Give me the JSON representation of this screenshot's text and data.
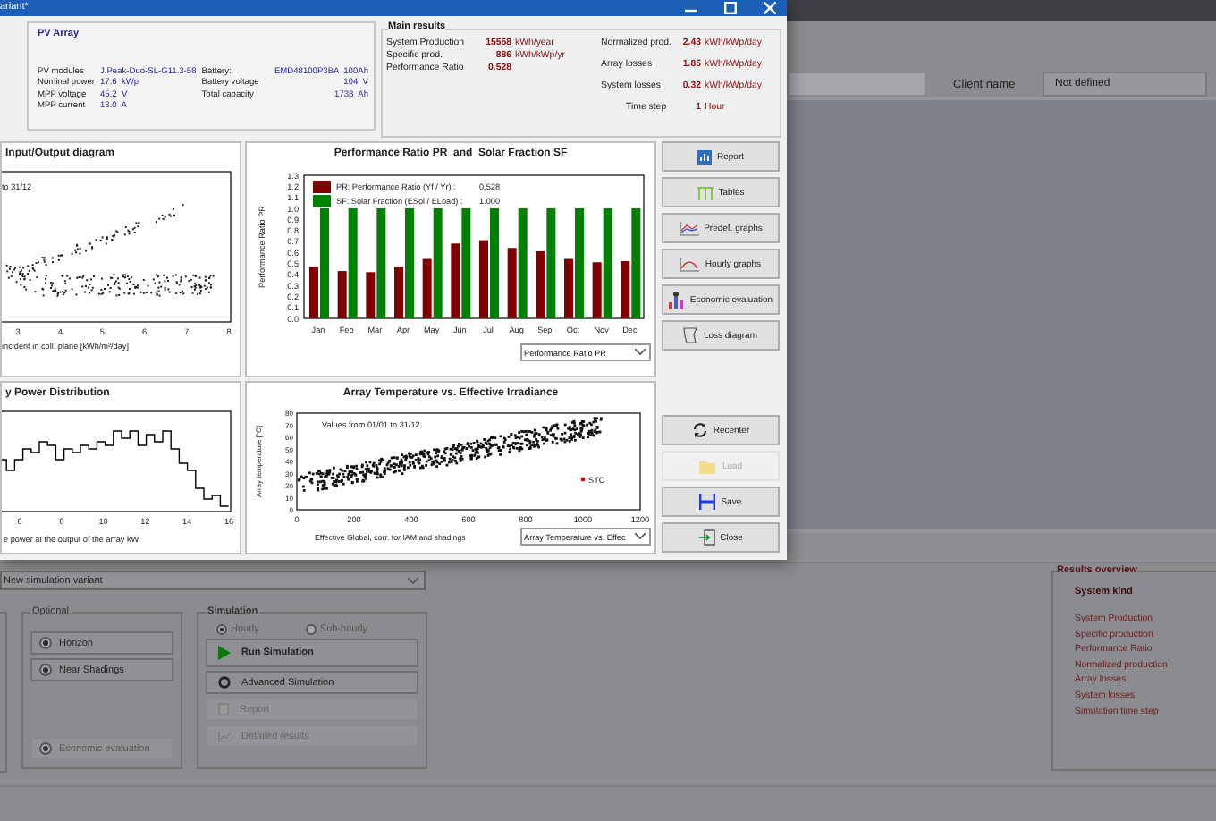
{
  "window": {
    "title": "ariant*"
  },
  "pv_array": {
    "title": "PV Array",
    "rows": [
      {
        "label": "PV modules",
        "value": "J.Peak-Duo-SL-G11.3-58",
        "label_2": "Battery:",
        "value_2": "EMD48100P3BA  100Ah"
      },
      {
        "label": "Nominal power",
        "value": "17.6  kWp",
        "label_2": "Battery voltage",
        "value_2": "104  V"
      },
      {
        "label": "MPP voltage",
        "value": "45.2  V",
        "label_2": "Total capacity",
        "value_2": "1738  Ah"
      },
      {
        "label": "MPP current",
        "value": "13.0  A"
      }
    ]
  },
  "main_results": {
    "title": "Main results",
    "left": [
      {
        "label": "System Production",
        "value": "15558",
        "unit": "kWh/year"
      },
      {
        "label": "Specific prod.",
        "value": "886",
        "unit": "kWh/kWp/yr"
      },
      {
        "label": "Performance Ratio",
        "value": "0.528"
      }
    ],
    "right": [
      {
        "label": "Normalized prod.",
        "value": "2.43",
        "unit": "kWh/kWp/day"
      },
      {
        "label": "Array losses",
        "value": "1.85",
        "unit": "kWh/kWp/day"
      },
      {
        "label": "System losses",
        "value": "0.32",
        "unit": "kWh/kWp/day"
      },
      {
        "label": "Time step",
        "value": "1",
        "unit": "Hour"
      }
    ]
  },
  "charts": [
    {
      "kind": "io_scatter",
      "title": "Input/Output diagram",
      "note": "to 31/12",
      "xticks": [
        "3",
        "4",
        "5",
        "6",
        "7",
        "8"
      ],
      "xlabel": "incident in coll. plane [kWh/m²/day]"
    },
    {
      "kind": "bar",
      "title": "Performance Ratio PR  and  Solar Fraction SF",
      "legend_values": [
        "0.528",
        "1.000"
      ],
      "dropdown": "Performance Ratio PR",
      "chart_data": {
        "type": "bar",
        "ylabel": "Performance Ratio PR",
        "categories": [
          "Jan",
          "Feb",
          "Mar",
          "Apr",
          "May",
          "Jun",
          "Jul",
          "Aug",
          "Sep",
          "Oct",
          "Nov",
          "Dec"
        ],
        "series": [
          {
            "name": "PR: Performance Ratio (Yf / Yr) :",
            "color": "#800000",
            "values": [
              0.47,
              0.43,
              0.42,
              0.47,
              0.54,
              0.68,
              0.71,
              0.64,
              0.61,
              0.54,
              0.51,
              0.52
            ]
          },
          {
            "name": "SF: Solar Fraction (ESol / ELoad) :",
            "color": "#008000",
            "values": [
              1.0,
              1.0,
              1.0,
              1.0,
              1.0,
              1.0,
              1.0,
              1.0,
              1.0,
              1.0,
              1.0,
              1.0
            ]
          }
        ],
        "legend": "upper left",
        "ylim": [
          0,
          1.3
        ],
        "yticks": [
          {
            "value": 0,
            "label": "0.0"
          },
          {
            "value": 0.1,
            "label": "0.1"
          },
          {
            "value": 0.2,
            "label": "0.2"
          },
          {
            "value": 0.3,
            "label": "0.3"
          },
          {
            "value": 0.4,
            "label": "0.4"
          },
          {
            "value": 0.5,
            "label": "0.5"
          },
          {
            "value": 0.6,
            "label": "0.6"
          },
          {
            "value": 0.7,
            "label": "0.7"
          },
          {
            "value": 0.8,
            "label": "0.8"
          },
          {
            "value": 0.9,
            "label": "0.9"
          },
          {
            "value": 1.0,
            "label": "1.0"
          },
          {
            "value": 1.1,
            "label": "1.1"
          },
          {
            "value": 1.2,
            "label": "1.2"
          },
          {
            "value": 1.3,
            "label": "1.3"
          }
        ]
      }
    },
    {
      "kind": "histogram",
      "title": "y Power Distribution",
      "xticks": [
        "6",
        "8",
        "10",
        "12",
        "14",
        "16"
      ],
      "xlabel": "e power at the output of the array kW"
    },
    {
      "kind": "temp_scatter",
      "title": "Array Temperature vs. Effective Irradiance",
      "note": "Values from 01/01 to 31/12",
      "marker": "STC",
      "ylabel": "Array temperature [°C]",
      "xticks": [
        "0",
        "200",
        "400",
        "600",
        "800",
        "1000",
        "1200"
      ],
      "yticks": [
        "80",
        "70",
        "60",
        "50",
        "40",
        "30",
        "20",
        "10",
        "0"
      ],
      "xlabel": "Effective Global, corr. for IAM and shadings",
      "dropdown": "Array Temperature vs. Effec"
    }
  ],
  "analysis_buttons": [
    {
      "label": "Report",
      "disabled": false
    },
    {
      "label": "Tables",
      "disabled": false
    },
    {
      "label": "Predef. graphs",
      "disabled": false
    },
    {
      "label": "Hourly graphs",
      "disabled": false
    },
    {
      "label": "Economic evaluation",
      "disabled": false
    },
    {
      "label": "Loss diagram",
      "disabled": false
    }
  ],
  "action_buttons": [
    {
      "label": "Recenter",
      "disabled": false
    },
    {
      "label": "Load",
      "disabled": true
    },
    {
      "label": "Save",
      "disabled": false
    },
    {
      "label": "Close",
      "disabled": false
    }
  ],
  "background": {
    "client": {
      "label": "Client name",
      "value": "Not defined"
    },
    "variant": "New simulation variant",
    "optional": {
      "title": "Optional",
      "items": [
        {
          "label": "Horizon",
          "checked": true,
          "disabled": false
        },
        {
          "label": "Near Shadings",
          "checked": true,
          "disabled": false
        },
        {
          "label": "Economic evaluation",
          "checked": true,
          "disabled": true
        }
      ]
    },
    "simulation": {
      "title": "Simulation",
      "radios": [
        {
          "label": "Hourly",
          "selected": true
        },
        {
          "label": "Sub-hourly",
          "selected": false
        }
      ],
      "buttons": [
        {
          "label": "Run Simulation",
          "disabled": false
        },
        {
          "label": "Advanced Simulation",
          "disabled": false
        },
        {
          "label": "Report",
          "disabled": true
        },
        {
          "label": "Detailed results",
          "disabled": true
        }
      ]
    },
    "results_overview": {
      "title": "Results overview",
      "header": "System kind",
      "items": [
        "System Production",
        "Specific production",
        "Performance Ratio",
        "Normalized production",
        "Array losses",
        "System losses",
        "Simulation time step"
      ]
    }
  }
}
